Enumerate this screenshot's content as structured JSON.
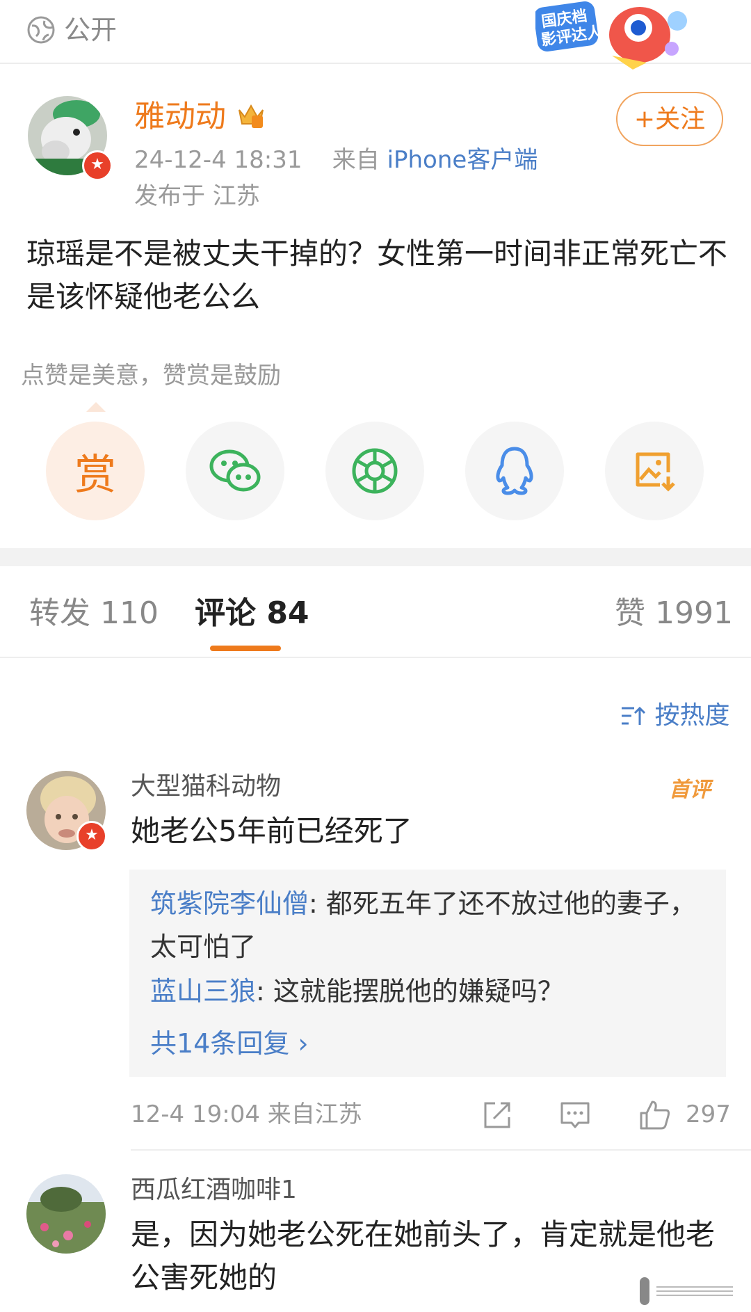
{
  "topbar": {
    "visibility_label": "公开",
    "badge_text": "国庆档影评达人"
  },
  "post": {
    "author_name": "雅动动",
    "timestamp": "24-12-4 18:31",
    "source_prefix": "来自",
    "source": "iPhone客户端",
    "location": "发布于 江苏",
    "follow_label": "+关注",
    "text": "琼瑶是不是被丈夫干掉的？女性第一时间非正常死亡不是该怀疑他老公么"
  },
  "reward": {
    "hint": "点赞是美意，赞赏是鼓励",
    "reward_label": "赏"
  },
  "tabs": [
    {
      "label": "转发 110"
    },
    {
      "label": "评论 84"
    },
    {
      "label": "赞 1991"
    }
  ],
  "sort_label": "按热度",
  "comments": [
    {
      "user": "大型猫科动物",
      "badge": "首评",
      "text": "她老公5年前已经死了",
      "replies": [
        {
          "user": "筑紫院李仙僧",
          "text": ": 都死五年了还不放过他的妻子，太可怕了"
        },
        {
          "user": "蓝山三狼",
          "text": ": 这就能摆脱他的嫌疑吗？"
        }
      ],
      "more_replies": "共14条回复 ›",
      "meta": "12-4 19:04 来自江苏",
      "likes": "297"
    },
    {
      "user": "西瓜红酒咖啡1",
      "text": "是，因为她老公死在她前头了，肯定就是他老公害死她的"
    }
  ],
  "colors": {
    "accent": "#ee7a1c",
    "link": "#4a7ec7",
    "verified": "#e8402a"
  }
}
